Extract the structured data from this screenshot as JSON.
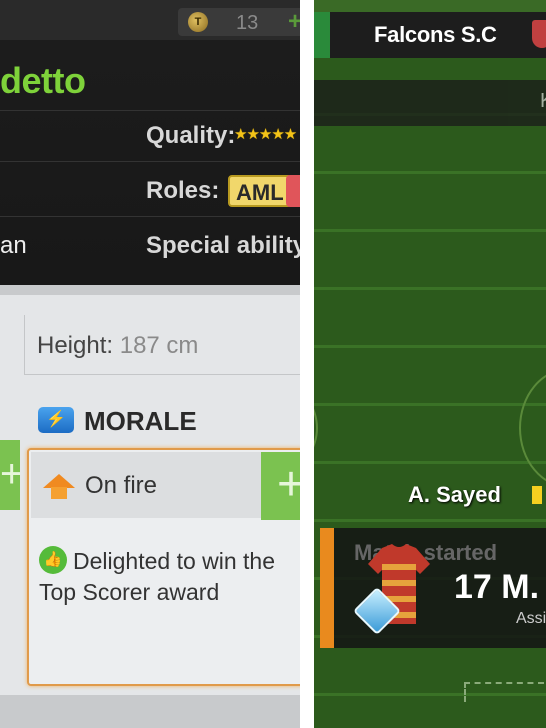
{
  "left_panel": {
    "currency": {
      "icon": "coin-icon",
      "glyph": "T",
      "count": "13",
      "add_label": "+"
    },
    "player": {
      "name_fragment": "detto"
    },
    "details": {
      "quality_label": "Quality:",
      "quality_stars": "★★★★★",
      "roles_label": "Roles:",
      "role_primary": "AML",
      "language_fragment": "an",
      "special_ability_label": "Special ability"
    },
    "height": {
      "label": "Height:",
      "value": "187 cm"
    },
    "morale": {
      "icon_glyph": "⚡",
      "title": "MORALE",
      "state": "On fire",
      "add_label": "+",
      "thumb_glyph": "👍",
      "description": "Delighted to win the Top Scorer award"
    }
  },
  "right_panel": {
    "team_name": "Falcons S.C",
    "strip_letter": "K",
    "scorer_name": "A. Sayed",
    "event": {
      "status": "Match started",
      "player": "17 M.",
      "sub_label": "Assi"
    }
  },
  "colors": {
    "accent_green": "#7ed23a",
    "morale_orange": "#e98a1e",
    "role_badge": "#f1d76b",
    "pitch_green": "#2c5a1c"
  }
}
